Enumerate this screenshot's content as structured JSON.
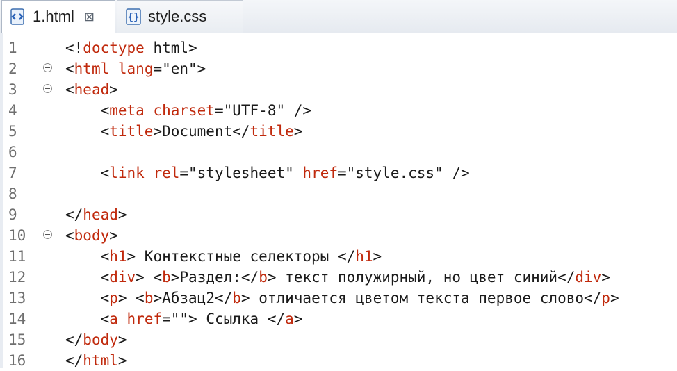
{
  "tabs": [
    {
      "label": "1.html",
      "icon": "html-file-icon",
      "active": true
    },
    {
      "label": "style.css",
      "icon": "css-file-icon",
      "active": false
    }
  ],
  "tab_close_glyph": "⊠",
  "colors": {
    "tag": "#c0290c",
    "text": "#1a1a1a",
    "line_number": "#6f6f6f"
  },
  "editor": {
    "lines": [
      {
        "num": "1",
        "fold": false,
        "tokens": [
          [
            "t",
            "<!"
          ],
          [
            "tag",
            "doctype"
          ],
          [
            "t",
            " html>"
          ]
        ]
      },
      {
        "num": "2",
        "fold": true,
        "tokens": [
          [
            "t",
            "<"
          ],
          [
            "tag",
            "html"
          ],
          [
            "t",
            " "
          ],
          [
            "tag",
            "lang"
          ],
          [
            "t",
            "=\"en\">"
          ]
        ]
      },
      {
        "num": "3",
        "fold": true,
        "tokens": [
          [
            "t",
            "<"
          ],
          [
            "tag",
            "head"
          ],
          [
            "t",
            ">"
          ]
        ]
      },
      {
        "num": "4",
        "fold": false,
        "tokens": [
          [
            "t",
            "    <"
          ],
          [
            "tag",
            "meta"
          ],
          [
            "t",
            " "
          ],
          [
            "tag",
            "charset"
          ],
          [
            "t",
            "=\"UTF-8\" />"
          ]
        ]
      },
      {
        "num": "5",
        "fold": false,
        "tokens": [
          [
            "t",
            "    <"
          ],
          [
            "tag",
            "title"
          ],
          [
            "t",
            ">Document</"
          ],
          [
            "tag",
            "title"
          ],
          [
            "t",
            ">"
          ]
        ]
      },
      {
        "num": "6",
        "fold": false,
        "tokens": []
      },
      {
        "num": "7",
        "fold": false,
        "tokens": [
          [
            "t",
            "    <"
          ],
          [
            "tag",
            "link"
          ],
          [
            "t",
            " "
          ],
          [
            "tag",
            "rel"
          ],
          [
            "t",
            "=\"stylesheet\" "
          ],
          [
            "tag",
            "href"
          ],
          [
            "t",
            "=\"style.css\" />"
          ]
        ]
      },
      {
        "num": "8",
        "fold": false,
        "tokens": []
      },
      {
        "num": "9",
        "fold": false,
        "tokens": [
          [
            "t",
            "</"
          ],
          [
            "tag",
            "head"
          ],
          [
            "t",
            ">"
          ]
        ]
      },
      {
        "num": "10",
        "fold": true,
        "tokens": [
          [
            "t",
            "<"
          ],
          [
            "tag",
            "body"
          ],
          [
            "t",
            ">"
          ]
        ]
      },
      {
        "num": "11",
        "fold": false,
        "tokens": [
          [
            "t",
            "    <"
          ],
          [
            "tag",
            "h1"
          ],
          [
            "t",
            "> Контекстные селекторы </"
          ],
          [
            "tag",
            "h1"
          ],
          [
            "t",
            ">"
          ]
        ]
      },
      {
        "num": "12",
        "fold": false,
        "tokens": [
          [
            "t",
            "    <"
          ],
          [
            "tag",
            "div"
          ],
          [
            "t",
            "> <"
          ],
          [
            "tag",
            "b"
          ],
          [
            "t",
            ">Раздел:</"
          ],
          [
            "tag",
            "b"
          ],
          [
            "t",
            "> текст полужирный, но цвет синий</"
          ],
          [
            "tag",
            "div"
          ],
          [
            "t",
            ">"
          ]
        ]
      },
      {
        "num": "13",
        "fold": false,
        "tokens": [
          [
            "t",
            "    <"
          ],
          [
            "tag",
            "p"
          ],
          [
            "t",
            "> <"
          ],
          [
            "tag",
            "b"
          ],
          [
            "t",
            ">Абзац2</"
          ],
          [
            "tag",
            "b"
          ],
          [
            "t",
            "> отличается цветом текста первое слово</"
          ],
          [
            "tag",
            "p"
          ],
          [
            "t",
            ">"
          ]
        ]
      },
      {
        "num": "14",
        "fold": false,
        "tokens": [
          [
            "t",
            "    <"
          ],
          [
            "tag",
            "a"
          ],
          [
            "t",
            " "
          ],
          [
            "tag",
            "href"
          ],
          [
            "t",
            "=\"\"> Ссылка </"
          ],
          [
            "tag",
            "a"
          ],
          [
            "t",
            ">"
          ]
        ]
      },
      {
        "num": "15",
        "fold": false,
        "tokens": [
          [
            "t",
            "</"
          ],
          [
            "tag",
            "body"
          ],
          [
            "t",
            ">"
          ]
        ]
      },
      {
        "num": "16",
        "fold": false,
        "tokens": [
          [
            "t",
            "</"
          ],
          [
            "tag",
            "html"
          ],
          [
            "t",
            ">"
          ]
        ]
      }
    ]
  }
}
